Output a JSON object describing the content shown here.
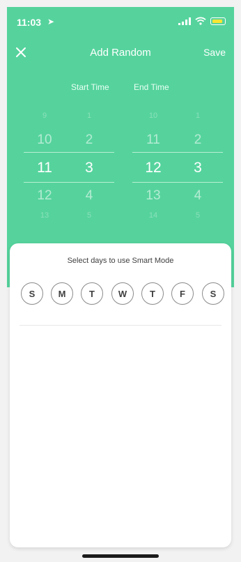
{
  "status": {
    "time": "11:03",
    "location_icon": "location-arrow-icon",
    "signal_icon": "signal-bars-icon",
    "wifi_icon": "wifi-icon",
    "battery_icon": "battery-charging-icon"
  },
  "nav": {
    "title": "Add Random",
    "close_icon": "close-icon",
    "save_label": "Save"
  },
  "picker": {
    "start_label": "Start Time",
    "end_label": "End Time",
    "start_left": [
      "9",
      "10",
      "11",
      "12",
      "13"
    ],
    "start_right": [
      "1",
      "2",
      "3",
      "4",
      "5"
    ],
    "end_left": [
      "10",
      "11",
      "12",
      "13",
      "14"
    ],
    "end_right": [
      "1",
      "2",
      "3",
      "4",
      "5"
    ]
  },
  "sheet": {
    "title": "Select days to use Smart Mode",
    "days": [
      "S",
      "M",
      "T",
      "W",
      "T",
      "F",
      "S"
    ]
  },
  "colors": {
    "accent": "#56d39d",
    "text_dark": "#404040",
    "day_border": "#8a8a8a"
  }
}
